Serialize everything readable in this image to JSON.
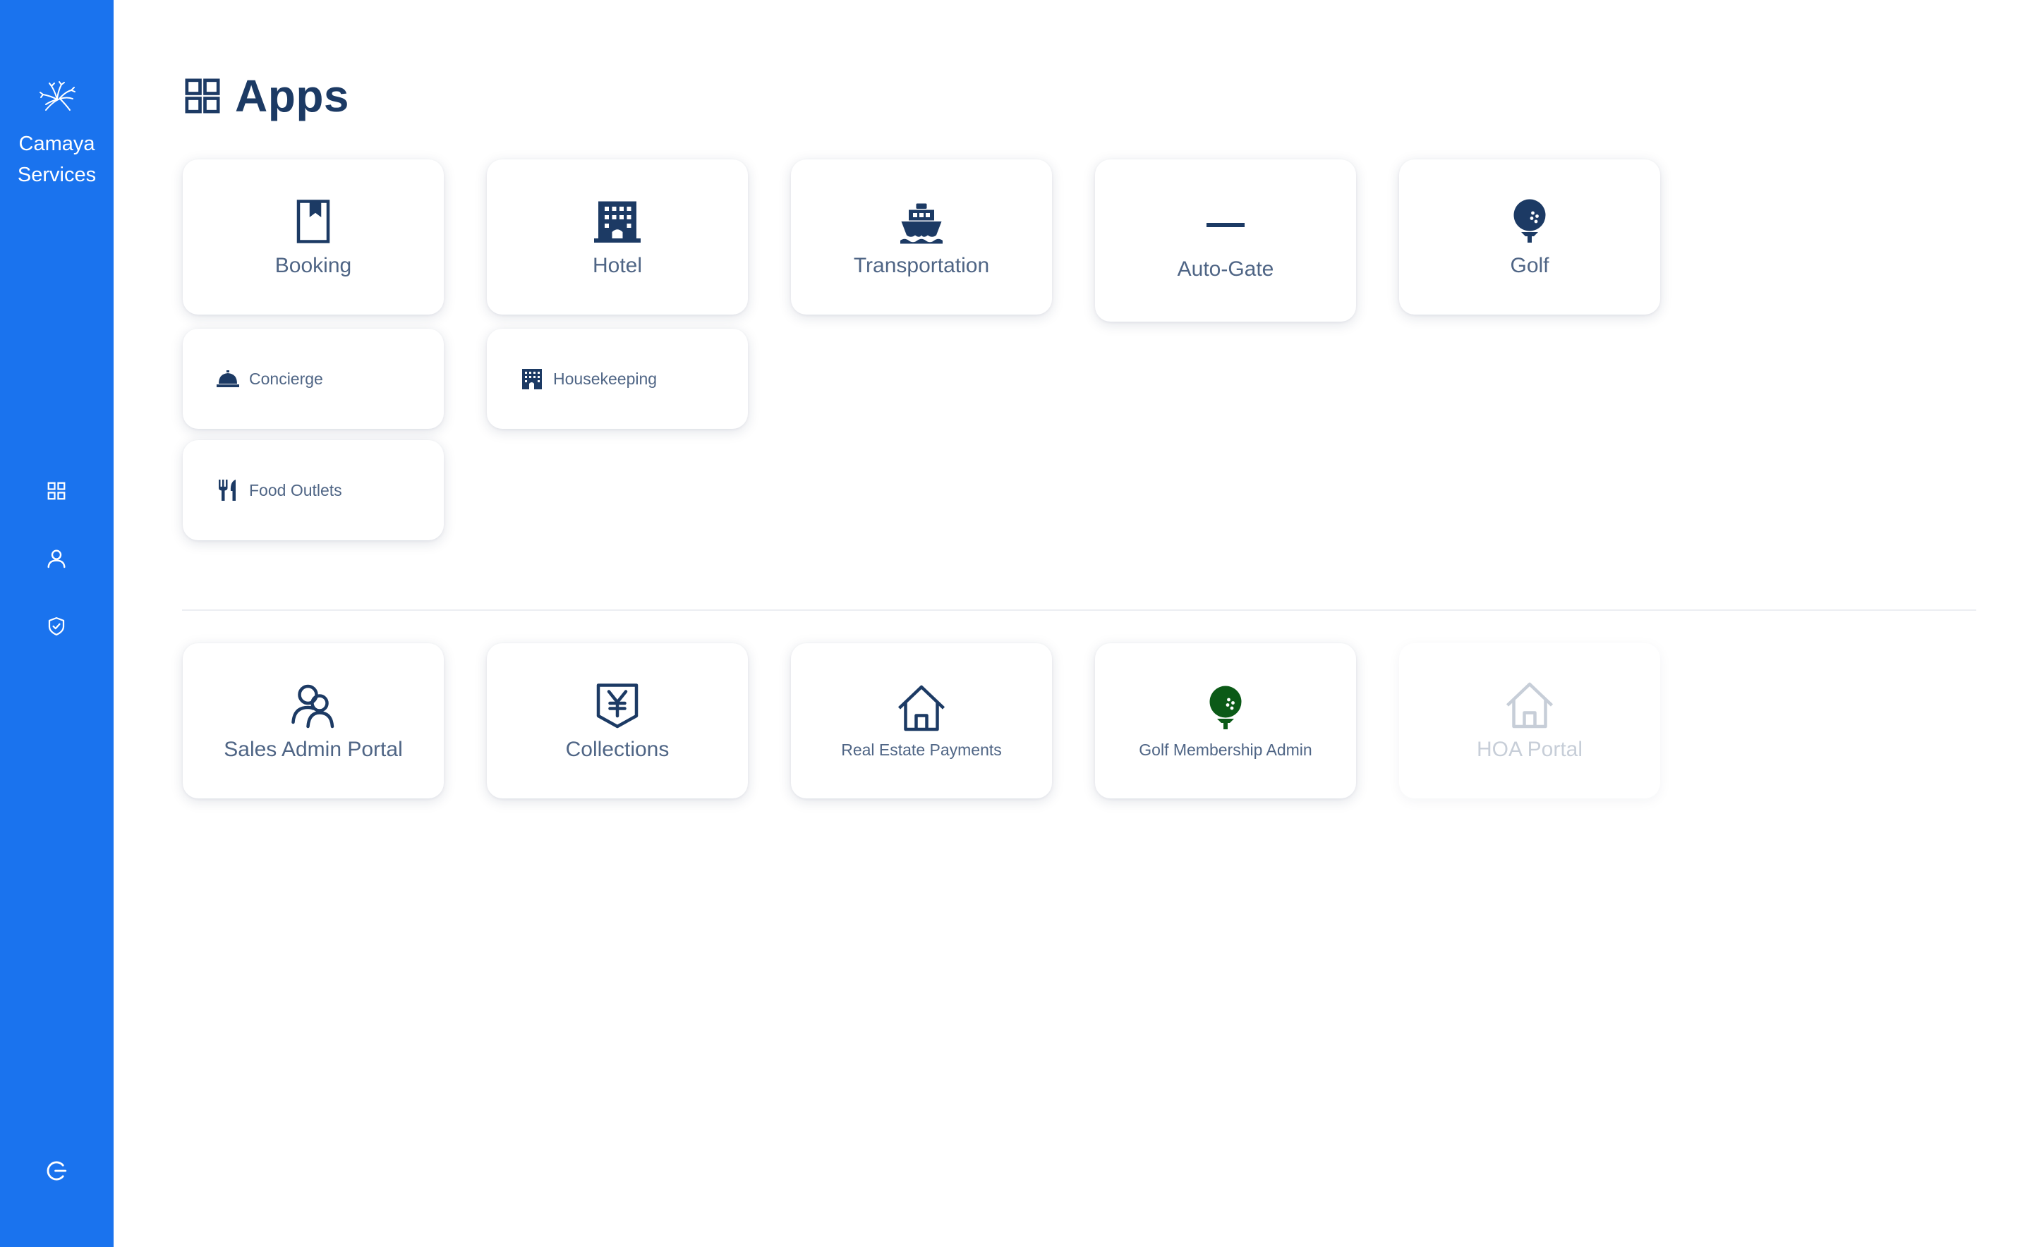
{
  "sidebar": {
    "brand_name": "Camaya\nServices",
    "nav": [
      {
        "icon": "grid-icon"
      },
      {
        "icon": "user-icon"
      },
      {
        "icon": "shield-check-icon"
      }
    ],
    "logout_icon": "logout-icon"
  },
  "header": {
    "title": "Apps",
    "icon": "grid-icon"
  },
  "apps_primary": [
    {
      "label": "Booking",
      "icon": "bookmark-icon"
    },
    {
      "label": "Hotel",
      "icon": "hotel-building-icon"
    },
    {
      "label": "Transportation",
      "icon": "ship-icon"
    },
    {
      "label": "Auto-Gate",
      "icon": "minus-icon"
    },
    {
      "label": "Golf",
      "icon": "golf-ball-icon"
    }
  ],
  "apps_secondary": [
    {
      "label": "Concierge",
      "icon": "concierge-bell-icon"
    },
    {
      "label": "Housekeeping",
      "icon": "building-icon"
    },
    {
      "label": "Food Outlets",
      "icon": "utensils-icon"
    }
  ],
  "apps_admin": [
    {
      "label": "Sales Admin Portal",
      "icon": "users-icon"
    },
    {
      "label": "Collections",
      "icon": "yen-shield-icon"
    },
    {
      "label": "Real Estate Payments",
      "icon": "house-icon"
    },
    {
      "label": "Golf Membership Admin",
      "icon": "golf-ball-icon"
    },
    {
      "label": "HOA Portal",
      "icon": "house-icon",
      "disabled": true
    }
  ],
  "colors": {
    "sidebar_bg": "#1a73ee",
    "icon_navy": "#1c3a64",
    "label_gray": "#4f6585",
    "golf_green": "#0b5a17",
    "disabled_gray": "#c7ced8"
  }
}
